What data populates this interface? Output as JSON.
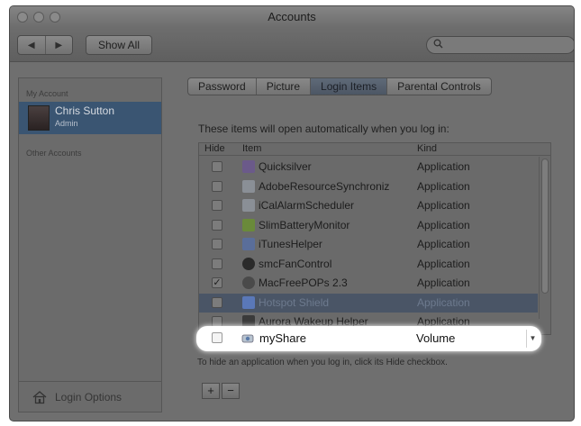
{
  "window": {
    "title": "Accounts"
  },
  "toolbar": {
    "back": "◀",
    "forward": "▶",
    "show_all": "Show All",
    "search_placeholder": ""
  },
  "sidebar": {
    "my_account_label": "My Account",
    "account_name": "Chris Sutton",
    "account_role": "Admin",
    "other_accounts_label": "Other Accounts",
    "login_options": "Login Options"
  },
  "tabs": [
    "Password",
    "Picture",
    "Login Items",
    "Parental Controls"
  ],
  "active_tab": "Login Items",
  "main": {
    "intro": "These items will open automatically when you log in:",
    "columns": {
      "hide": "Hide",
      "item": "Item",
      "kind": "Kind"
    },
    "rows": [
      {
        "name": "Quicksilver",
        "kind": "Application",
        "checked": false,
        "icon": "quicksilver-icon"
      },
      {
        "name": "AdobeResourceSynchroniz",
        "kind": "Application",
        "checked": false,
        "icon": "adobe-sync-icon"
      },
      {
        "name": "iCalAlarmScheduler",
        "kind": "Application",
        "checked": false,
        "icon": "ical-icon"
      },
      {
        "name": "SlimBatteryMonitor",
        "kind": "Application",
        "checked": false,
        "icon": "battery-icon"
      },
      {
        "name": "iTunesHelper",
        "kind": "Application",
        "checked": false,
        "icon": "itunes-icon"
      },
      {
        "name": "smcFanControl",
        "kind": "Application",
        "checked": false,
        "icon": "fan-icon"
      },
      {
        "name": "MacFreePOPs 2.3",
        "kind": "Application",
        "checked": true,
        "icon": "macfreepops-icon"
      },
      {
        "name": "Hotspot Shield",
        "kind": "Application",
        "checked": false,
        "icon": "shield-icon",
        "selected": true
      },
      {
        "name": "Aurora Wakeup Helper",
        "kind": "Application",
        "checked": false,
        "icon": "aurora-icon"
      }
    ],
    "highlight_row": {
      "name": "myShare",
      "kind": "Volume",
      "checked": false,
      "icon": "volume-icon"
    },
    "hint": "To hide an application when you log in, click its Hide checkbox.",
    "add_label": "+",
    "remove_label": "−"
  },
  "colors": {
    "selected_row": "#4a5566",
    "accent_account": "#3a5572"
  }
}
